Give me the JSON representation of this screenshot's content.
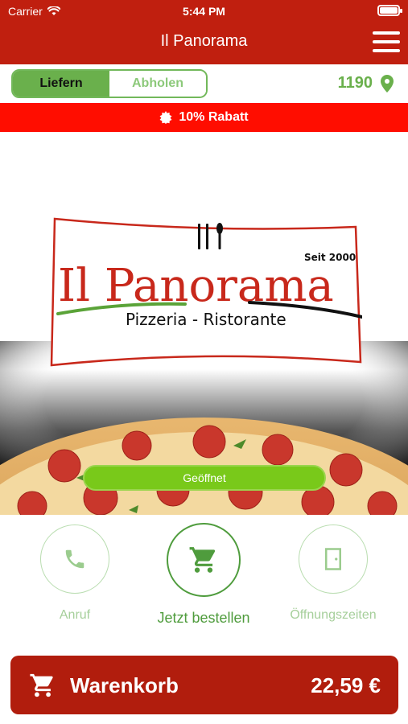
{
  "status_bar": {
    "carrier": "Carrier",
    "time": "5:44 PM"
  },
  "header": {
    "title": "Il Panorama"
  },
  "delivery": {
    "tabs": [
      {
        "label": "Liefern",
        "active": true
      },
      {
        "label": "Abholen",
        "active": false
      }
    ],
    "postal_code": "1190"
  },
  "promo": {
    "text": "10% Rabatt"
  },
  "logo": {
    "name": "Il Panorama",
    "tagline": "Pizzeria - Ristorante",
    "since": "Seit 2000"
  },
  "hero": {
    "status": "Geöffnet"
  },
  "actions": [
    {
      "label": "Anruf",
      "icon": "phone-icon"
    },
    {
      "label": "Jetzt bestellen",
      "icon": "cart-icon"
    },
    {
      "label": "Öffnungszeiten",
      "icon": "door-icon"
    }
  ],
  "cart": {
    "label": "Warenkorb",
    "total": "22,59 €"
  },
  "colors": {
    "header_red": "#c01f0f",
    "promo_red": "#ff0d00",
    "green": "#6ab04c",
    "open_green": "#79c91a",
    "cart_red": "#b11d0d"
  }
}
